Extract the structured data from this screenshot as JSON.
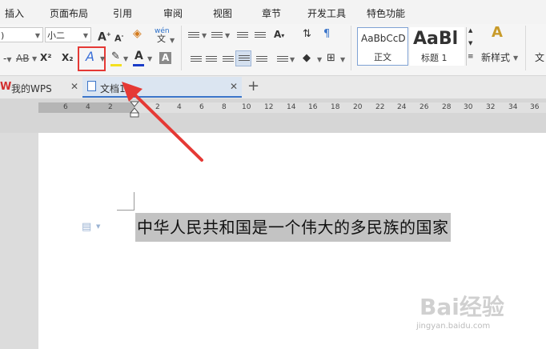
{
  "menu": [
    "插入",
    "页面布局",
    "引用",
    "审阅",
    "视图",
    "章节",
    "开发工具",
    "特色功能"
  ],
  "font": {
    "name_value": ")",
    "size_value": "小二"
  },
  "ribbon": {
    "strike_label": "AB",
    "superscript_label": "X²",
    "subscript_label": "X₂",
    "text_effect_glyph": "A",
    "font_color_glyph": "A",
    "char_shading_glyph": "A",
    "grow_font_glyph": "A",
    "shrink_font_glyph": "A",
    "pinyin_top": "wén",
    "pinyin_bottom": "文",
    "styles": [
      {
        "preview": "AaBbCcD",
        "label": "正文"
      },
      {
        "preview": "AaBl",
        "label": "标题 1"
      }
    ],
    "new_style_label": "新样式",
    "text_tools_label": "文",
    "highlight_color": "#f4e020",
    "font_color_accent": "#1a3cc8",
    "effect_box_color": "#e53935"
  },
  "tabs": [
    {
      "label": "我的WPS"
    },
    {
      "label": "文档1 *"
    }
  ],
  "ruler": {
    "left_numbers": [
      "6",
      "4",
      "2"
    ],
    "right_numbers": [
      "2",
      "4",
      "6",
      "8",
      "10",
      "12",
      "14",
      "16",
      "18",
      "20",
      "22",
      "24",
      "26",
      "28",
      "30",
      "32",
      "34",
      "36"
    ]
  },
  "document": {
    "text": "中华人民共和国是一个伟大的多民族的国家"
  },
  "watermark": {
    "brand": "Bai经验",
    "url": "jingyan.baidu.com"
  }
}
